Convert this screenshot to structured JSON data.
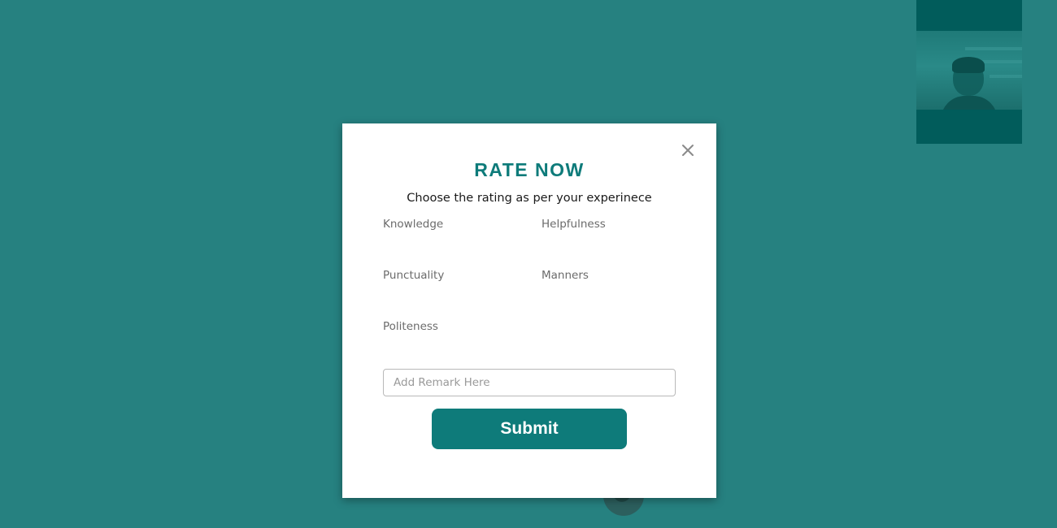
{
  "colors": {
    "page_background": "#268180",
    "accent": "#0e7b7a",
    "dialog_background": "#ffffff"
  },
  "video": {
    "self_preview_icon": "camera-feed"
  },
  "call_controls": {
    "end_call_icon": "phone-icon"
  },
  "dialog": {
    "title": "RATE NOW",
    "subtitle": "Choose the rating as per your experinece",
    "close_icon": "close-icon",
    "criteria": [
      {
        "label": "Knowledge"
      },
      {
        "label": "Helpfulness"
      },
      {
        "label": "Punctuality"
      },
      {
        "label": "Manners"
      },
      {
        "label": "Politeness"
      }
    ],
    "remark": {
      "placeholder": "Add Remark Here",
      "value": ""
    },
    "submit_label": "Submit"
  }
}
